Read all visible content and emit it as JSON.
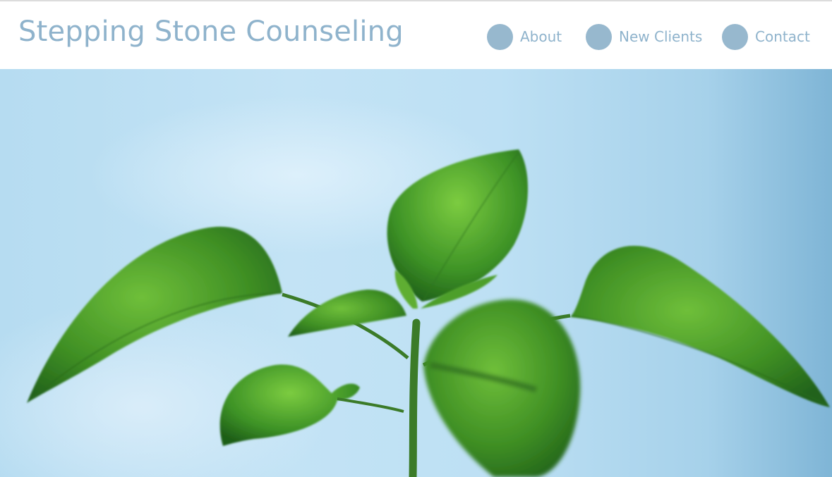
{
  "header": {
    "brand": "Stepping Stone Counseling",
    "nav": [
      {
        "label": "About",
        "icon": "circle-icon"
      },
      {
        "label": "New Clients",
        "icon": "circle-icon"
      },
      {
        "label": "Contact",
        "icon": "circle-icon"
      }
    ]
  },
  "colors": {
    "brand": "#8fb3cc",
    "nav_dot": "#97b8ce",
    "sky": "#bde0f4",
    "leaf": "#3f8f24"
  }
}
